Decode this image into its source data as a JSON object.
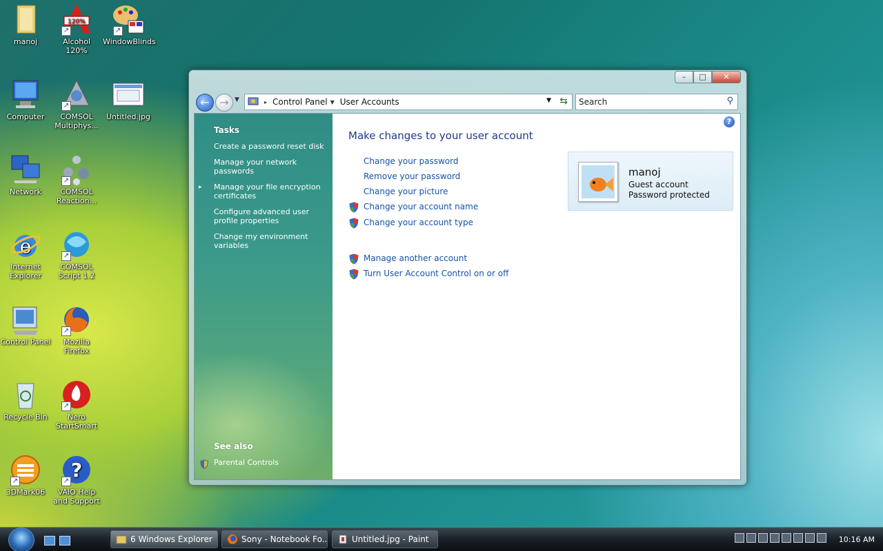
{
  "desktop": {
    "icons": [
      {
        "label": "manoj"
      },
      {
        "label": "Alcohol 120%"
      },
      {
        "label": "WindowBlinds"
      },
      {
        "label": "Computer"
      },
      {
        "label": "COMSOL Multiphys..."
      },
      {
        "label": "Untitled.jpg"
      },
      {
        "label": "Network"
      },
      {
        "label": "COMSOL Reaction..."
      },
      {
        "label": "Internet Explorer"
      },
      {
        "label": "COMSOL Script 1.2"
      },
      {
        "label": "Control Panel"
      },
      {
        "label": "Mozilla Firefox"
      },
      {
        "label": "Recycle Bin"
      },
      {
        "label": "Nero StartSmart"
      },
      {
        "label": "3DMark06"
      },
      {
        "label": "VAIO Help and Support"
      }
    ]
  },
  "window": {
    "breadcrumb": [
      "Control Panel",
      "User Accounts"
    ],
    "search_placeholder": "Search",
    "tasks_heading": "Tasks",
    "tasks": [
      "Create a password reset disk",
      "Manage your network passwords",
      "Manage your file encryption certificates",
      "Configure advanced user profile properties",
      "Change my environment variables"
    ],
    "see_also_heading": "See also",
    "see_also": [
      "Parental Controls"
    ],
    "title": "Make changes to your user account",
    "links": [
      "Change your password",
      "Remove your password",
      "Change your picture",
      "Change your account name",
      "Change your account type"
    ],
    "links2": [
      "Manage another account",
      "Turn User Account Control on or off"
    ],
    "account": {
      "name": "manoj",
      "type": "Guest account",
      "status": "Password protected"
    }
  },
  "taskbar": {
    "buttons": [
      {
        "label": "6 Windows Explorer"
      },
      {
        "label": "Sony - Notebook Fo..."
      },
      {
        "label": "Untitled.jpg - Paint"
      }
    ],
    "clock": "10:16 AM"
  }
}
